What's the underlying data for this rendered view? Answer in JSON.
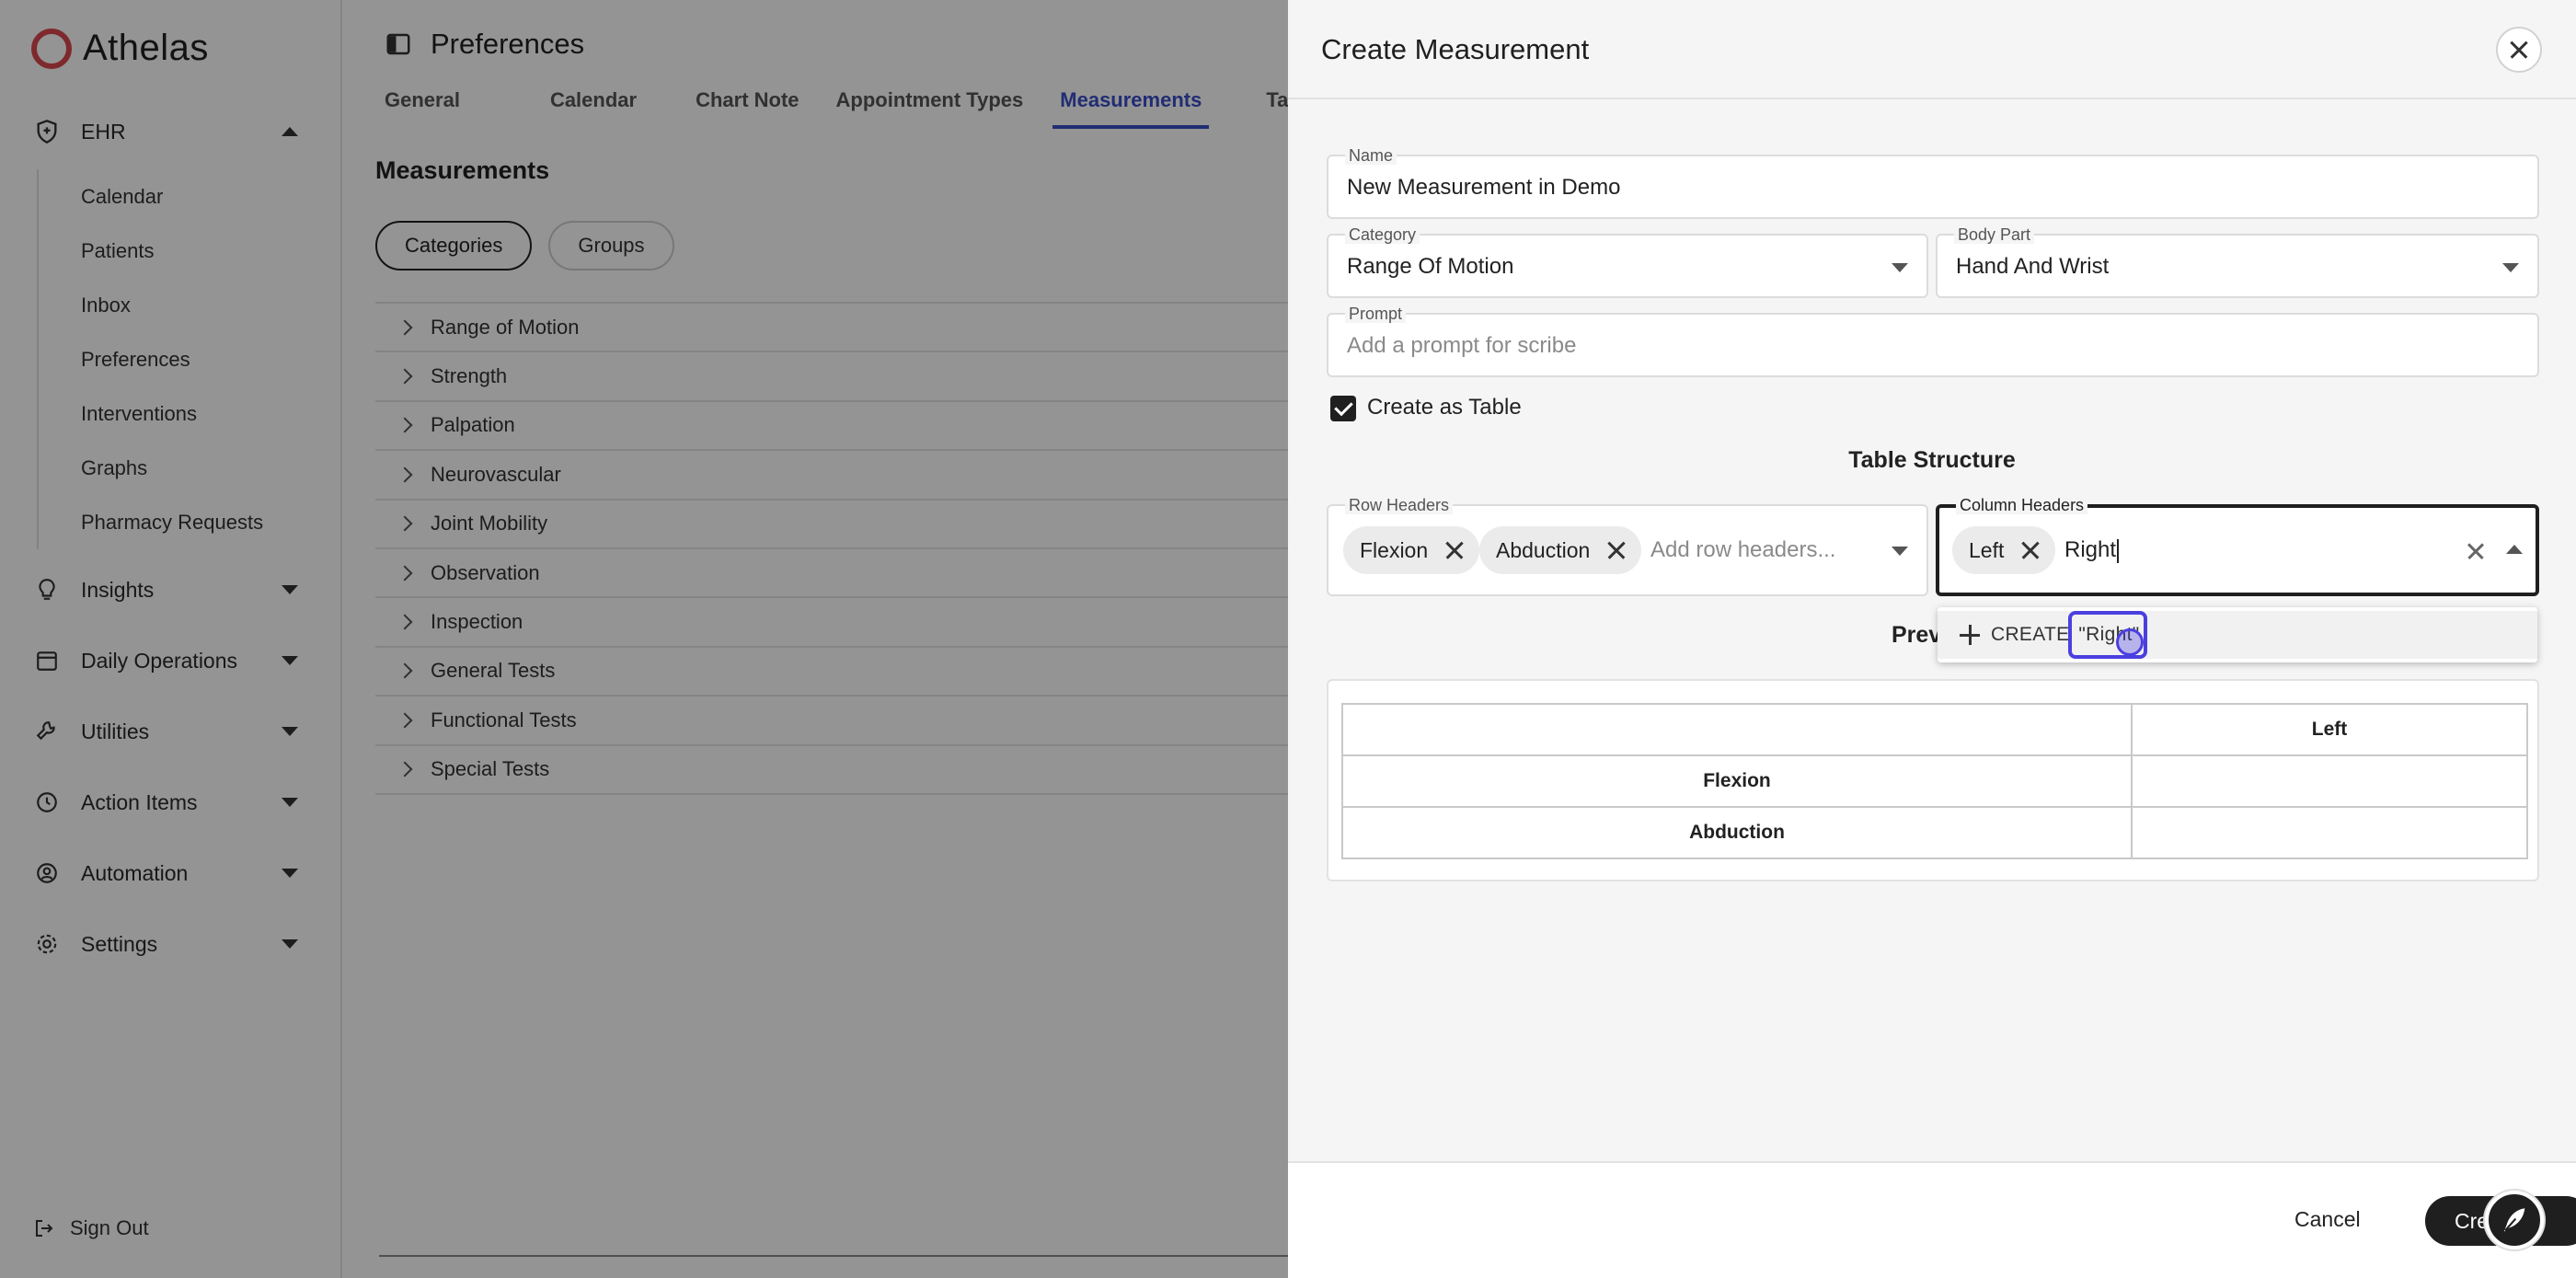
{
  "app": {
    "logo_text": "Athelas"
  },
  "sidebar": {
    "ehr_label": "EHR",
    "ehr_items": [
      {
        "label": "Calendar"
      },
      {
        "label": "Patients"
      },
      {
        "label": "Inbox"
      },
      {
        "label": "Preferences"
      },
      {
        "label": "Interventions"
      },
      {
        "label": "Graphs"
      },
      {
        "label": "Pharmacy Requests"
      }
    ],
    "sections": [
      {
        "label": "Insights",
        "icon": "lightbulb-icon"
      },
      {
        "label": "Daily Operations",
        "icon": "calendar-icon"
      },
      {
        "label": "Utilities",
        "icon": "wrench-icon"
      },
      {
        "label": "Action Items",
        "icon": "clock-icon"
      },
      {
        "label": "Automation",
        "icon": "automation-icon"
      },
      {
        "label": "Settings",
        "icon": "gear-icon"
      }
    ],
    "sign_out": "Sign Out"
  },
  "main": {
    "page_title": "Preferences",
    "tabs": [
      {
        "label": "General"
      },
      {
        "label": "Calendar"
      },
      {
        "label": "Chart Note"
      },
      {
        "label": "Appointment Types"
      },
      {
        "label": "Measurements"
      },
      {
        "label": "Tasks"
      }
    ],
    "active_tab": "Measurements",
    "section_title": "Measurements",
    "pills": [
      {
        "label": "Categories"
      },
      {
        "label": "Groups"
      }
    ],
    "categories": [
      {
        "label": "Range of Motion"
      },
      {
        "label": "Strength"
      },
      {
        "label": "Palpation"
      },
      {
        "label": "Neurovascular"
      },
      {
        "label": "Joint Mobility"
      },
      {
        "label": "Observation"
      },
      {
        "label": "Inspection"
      },
      {
        "label": "General Tests"
      },
      {
        "label": "Functional Tests"
      },
      {
        "label": "Special Tests"
      }
    ]
  },
  "drawer": {
    "title": "Create Measurement",
    "name": {
      "label": "Name",
      "value": "New Measurement in Demo"
    },
    "category": {
      "label": "Category",
      "value": "Range Of Motion"
    },
    "body_part": {
      "label": "Body Part",
      "value": "Hand And Wrist"
    },
    "prompt": {
      "label": "Prompt",
      "placeholder": "Add a prompt for scribe"
    },
    "create_as_table": {
      "label": "Create as Table",
      "checked": true
    },
    "table_structure_title": "Table Structure",
    "row_headers": {
      "label": "Row Headers",
      "chips": [
        "Flexion",
        "Abduction"
      ],
      "placeholder": "Add row headers..."
    },
    "column_headers": {
      "label": "Column Headers",
      "chips": [
        "Left"
      ],
      "typed": "Right"
    },
    "create_option": {
      "prefix": "CREATE",
      "value": "\"Right\""
    },
    "preview_label": "Prev",
    "preview_table": {
      "columns": [
        "",
        "Left"
      ],
      "rows": [
        "Flexion",
        "Abduction"
      ]
    },
    "cancel_label": "Cancel",
    "create_label": "Create"
  },
  "colors": {
    "accent": "#3a4fc7",
    "brand": "#d9474e",
    "highlight": "#4b3fe0"
  }
}
